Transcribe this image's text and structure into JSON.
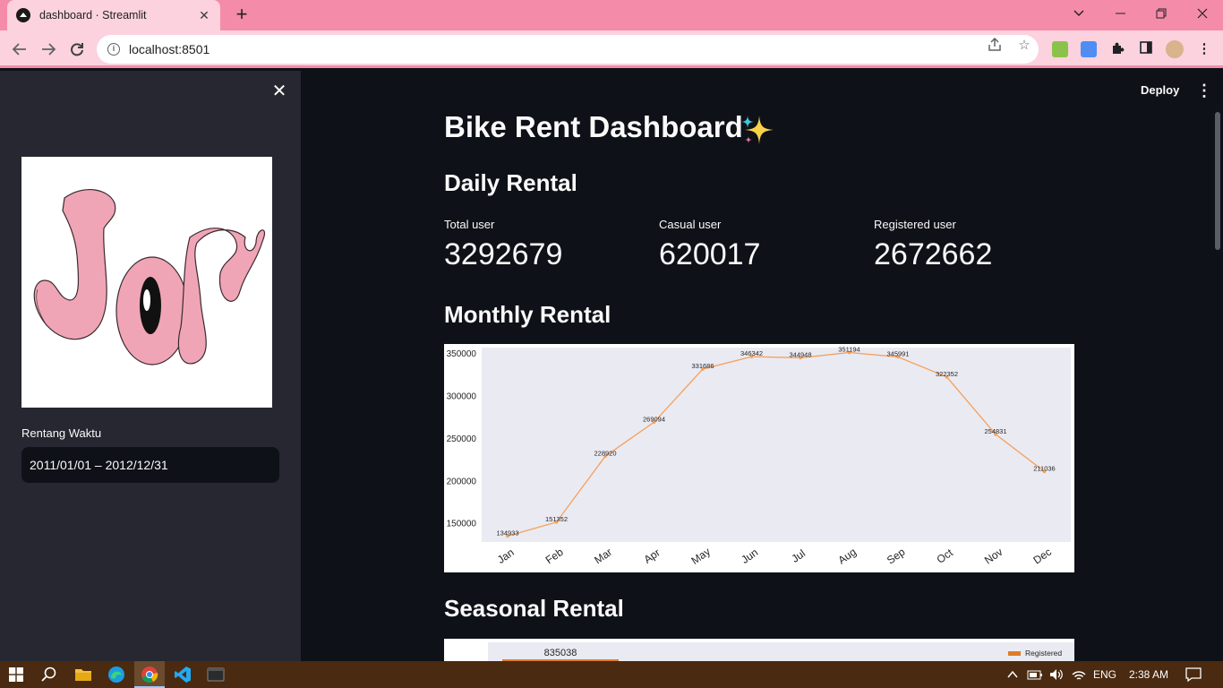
{
  "browser": {
    "tab_title": "dashboard · Streamlit",
    "url": "localhost:8501"
  },
  "app": {
    "deploy_label": "Deploy",
    "title": "Bike Rent Dashboard",
    "sidebar": {
      "date_label": "Rentang Waktu",
      "date_value": "2011/01/01 – 2012/12/31"
    },
    "daily_header": "Daily Rental",
    "metrics": [
      {
        "label": "Total user",
        "value": "3292679"
      },
      {
        "label": "Casual user",
        "value": "620017"
      },
      {
        "label": "Registered user",
        "value": "2672662"
      }
    ],
    "monthly_header": "Monthly Rental",
    "seasonal_header": "Seasonal Rental",
    "seasonal_preview": {
      "value_label": "835038",
      "legend": "Registered",
      "accent": "#e07b29"
    }
  },
  "chart_data": {
    "type": "line",
    "categories": [
      "Jan",
      "Feb",
      "Mar",
      "Apr",
      "May",
      "Jun",
      "Jul",
      "Aug",
      "Sep",
      "Oct",
      "Nov",
      "Dec"
    ],
    "series": [
      {
        "values": [
          134933,
          151352,
          228920,
          269094,
          331686,
          346342,
          344948,
          351194,
          345991,
          322352,
          254831,
          211036
        ]
      }
    ],
    "yticks": [
      "150000",
      "200000",
      "250000",
      "300000",
      "350000"
    ],
    "ylim": [
      128000,
      357000
    ],
    "line_color": "#f4a05a",
    "background": "#eaeaf2",
    "grid": false
  },
  "taskbar": {
    "language": "ENG",
    "time": "2:38 AM"
  }
}
